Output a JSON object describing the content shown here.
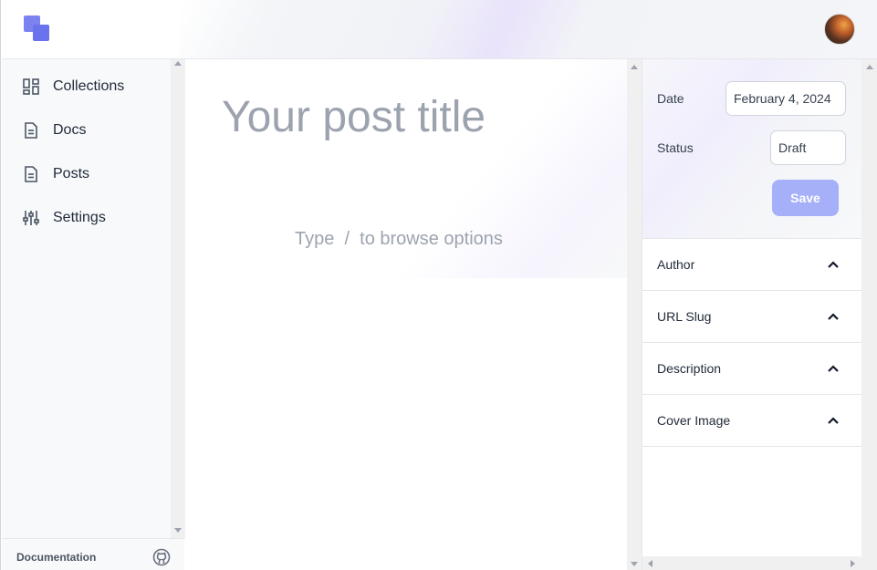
{
  "header": {
    "logo_icon": "app-logo",
    "avatar_icon": "user-avatar"
  },
  "sidebar": {
    "items": [
      {
        "label": "Collections",
        "icon": "grid-icon"
      },
      {
        "label": "Docs",
        "icon": "document-icon"
      },
      {
        "label": "Posts",
        "icon": "document-icon"
      },
      {
        "label": "Settings",
        "icon": "sliders-icon"
      }
    ],
    "footer": {
      "documentation_label": "Documentation",
      "github_icon": "github-icon"
    }
  },
  "editor": {
    "title_placeholder": "Your post title",
    "body_placeholder": "Type  /  to browse options"
  },
  "meta_panel": {
    "date_label": "Date",
    "date_value": "February 4, 2024",
    "status_label": "Status",
    "status_value": "Draft",
    "save_label": "Save",
    "sections": [
      {
        "label": "Author"
      },
      {
        "label": "URL Slug"
      },
      {
        "label": "Description"
      },
      {
        "label": "Cover Image"
      }
    ]
  },
  "colors": {
    "accent": "#6b72ee",
    "save_button": "#a5b0f9",
    "placeholder_text": "#9ca3af"
  }
}
